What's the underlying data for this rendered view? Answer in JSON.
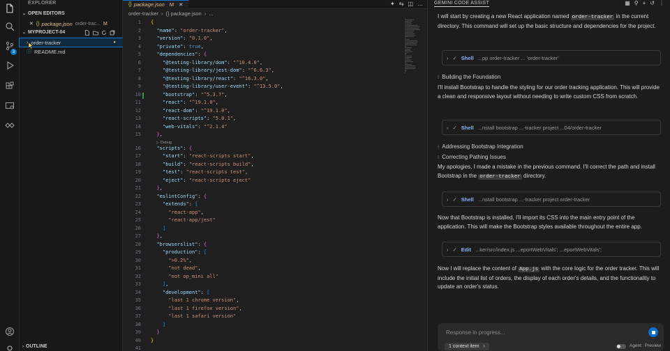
{
  "explorer": {
    "title": "EXPLORER",
    "open_editors_label": "OPEN EDITORS",
    "open_file": {
      "name": "package.json",
      "path": "order-trac...",
      "status": "M"
    },
    "project_label": "MYPROJECT-04",
    "tree": [
      {
        "name": "order-tracker",
        "type": "folder"
      },
      {
        "name": "README.md",
        "type": "file"
      }
    ],
    "outline_label": "OUTLINE",
    "scm_badge": "3"
  },
  "editor": {
    "tab": {
      "label": "package.json",
      "status": "M"
    },
    "breadcrumb": [
      "order-tracker",
      "{} package.json",
      "..."
    ],
    "codelens": "▷ Debug",
    "lines": [
      {
        "n": "1",
        "text": "{"
      },
      {
        "n": "2",
        "text": "  \"name\": \"order-tracker\","
      },
      {
        "n": "3",
        "text": "  \"version\": \"0.1.0\","
      },
      {
        "n": "4",
        "text": "  \"private\": true,"
      },
      {
        "n": "5",
        "text": "  \"dependencies\": {"
      },
      {
        "n": "6",
        "text": "    \"@testing-library/dom\": \"^10.4.0\","
      },
      {
        "n": "7",
        "text": "    \"@testing-library/jest-dom\": \"^6.6.3\","
      },
      {
        "n": "8",
        "text": "    \"@testing-library/react\": \"^16.3.0\","
      },
      {
        "n": "9",
        "text": "    \"@testing-library/user-event\": \"^13.5.0\","
      },
      {
        "n": "10",
        "text": "    \"bootstrap\": \"^5.3.7\","
      },
      {
        "n": "11",
        "text": "    \"react\": \"^19.1.0\","
      },
      {
        "n": "12",
        "text": "    \"react-dom\": \"^19.1.0\","
      },
      {
        "n": "13",
        "text": "    \"react-scripts\": \"5.0.1\","
      },
      {
        "n": "14",
        "text": "    \"web-vitals\": \"^2.1.4\""
      },
      {
        "n": "15",
        "text": "  },"
      },
      {
        "n": "16",
        "text": "  \"scripts\": {"
      },
      {
        "n": "17",
        "text": "    \"start\": \"react-scripts start\","
      },
      {
        "n": "18",
        "text": "    \"build\": \"react-scripts build\","
      },
      {
        "n": "19",
        "text": "    \"test\": \"react-scripts test\","
      },
      {
        "n": "20",
        "text": "    \"eject\": \"react-scripts eject\""
      },
      {
        "n": "21",
        "text": "  },"
      },
      {
        "n": "22",
        "text": "  \"eslintConfig\": {"
      },
      {
        "n": "23",
        "text": "    \"extends\": ["
      },
      {
        "n": "24",
        "text": "      \"react-app\","
      },
      {
        "n": "25",
        "text": "      \"react-app/jest\""
      },
      {
        "n": "26",
        "text": "    ]"
      },
      {
        "n": "27",
        "text": "  },"
      },
      {
        "n": "28",
        "text": "  \"browserslist\": {"
      },
      {
        "n": "29",
        "text": "    \"production\": ["
      },
      {
        "n": "30",
        "text": "      \">0.2%\","
      },
      {
        "n": "31",
        "text": "      \"not dead\","
      },
      {
        "n": "32",
        "text": "      \"not op_mini all\""
      },
      {
        "n": "33",
        "text": "    ],"
      },
      {
        "n": "34",
        "text": "    \"development\": ["
      },
      {
        "n": "35",
        "text": "      \"last 1 chrome version\","
      },
      {
        "n": "36",
        "text": "      \"last 1 firefox version\","
      },
      {
        "n": "37",
        "text": "      \"last 1 safari version\""
      },
      {
        "n": "38",
        "text": "    ]"
      },
      {
        "n": "39",
        "text": "  }"
      },
      {
        "n": "40",
        "text": "}"
      },
      {
        "n": "41",
        "text": ""
      }
    ]
  },
  "assist": {
    "title": "GEMINI CODE ASSIST",
    "intro": {
      "before": "I will start by creating a new React application named ",
      "chip": "order-tracker",
      "after": " in the current directory. This command will set up the basic structure and dependencies for the project."
    },
    "tool1": {
      "name": "Shell",
      "desc": "...pp order-tracker ... 'order-tracker'"
    },
    "thought1": "Building the Foundation",
    "para2": "I'll install Bootstrap to handle the styling for our order tracking application. This will provide a clean and responsive layout without needing to write custom CSS from scratch.",
    "tool2": {
      "name": "Shell",
      "desc": "...nstall bootstrap ...-tracker project ...04/order-tracker"
    },
    "thought2": "Addressing Bootstrap Integration",
    "thought3": "Correcting Pathing Issues",
    "para3": {
      "before": "My apologies, I made a mistake in the previous command. I'll correct the path and install Bootstrap in the ",
      "chip": "order-tracker",
      "after": " directory."
    },
    "tool3": {
      "name": "Shell",
      "desc": "...nstall bootstrap ...-tracker project order-tracker"
    },
    "para4": "Now that Bootstrap is installed, I'll import its CSS into the main entry point of the application. This will make the Bootstrap styles available throughout the entire app.",
    "tool4": {
      "name": "Edit",
      "desc": "...ker/src/index.js ...eportWebVitals'; ...eportWebVitals';"
    },
    "para5": {
      "before": "Now I will replace the content of ",
      "chip": "App.js",
      "after": " with the core logic for the order tracker. This will include the initial list of orders, the display of each order's details, and the functionality to update an order's status."
    },
    "input_placeholder": "Response in progress...",
    "context_chip": "1 context item",
    "agent_label": "Agent",
    "preview_label": "Preview"
  }
}
